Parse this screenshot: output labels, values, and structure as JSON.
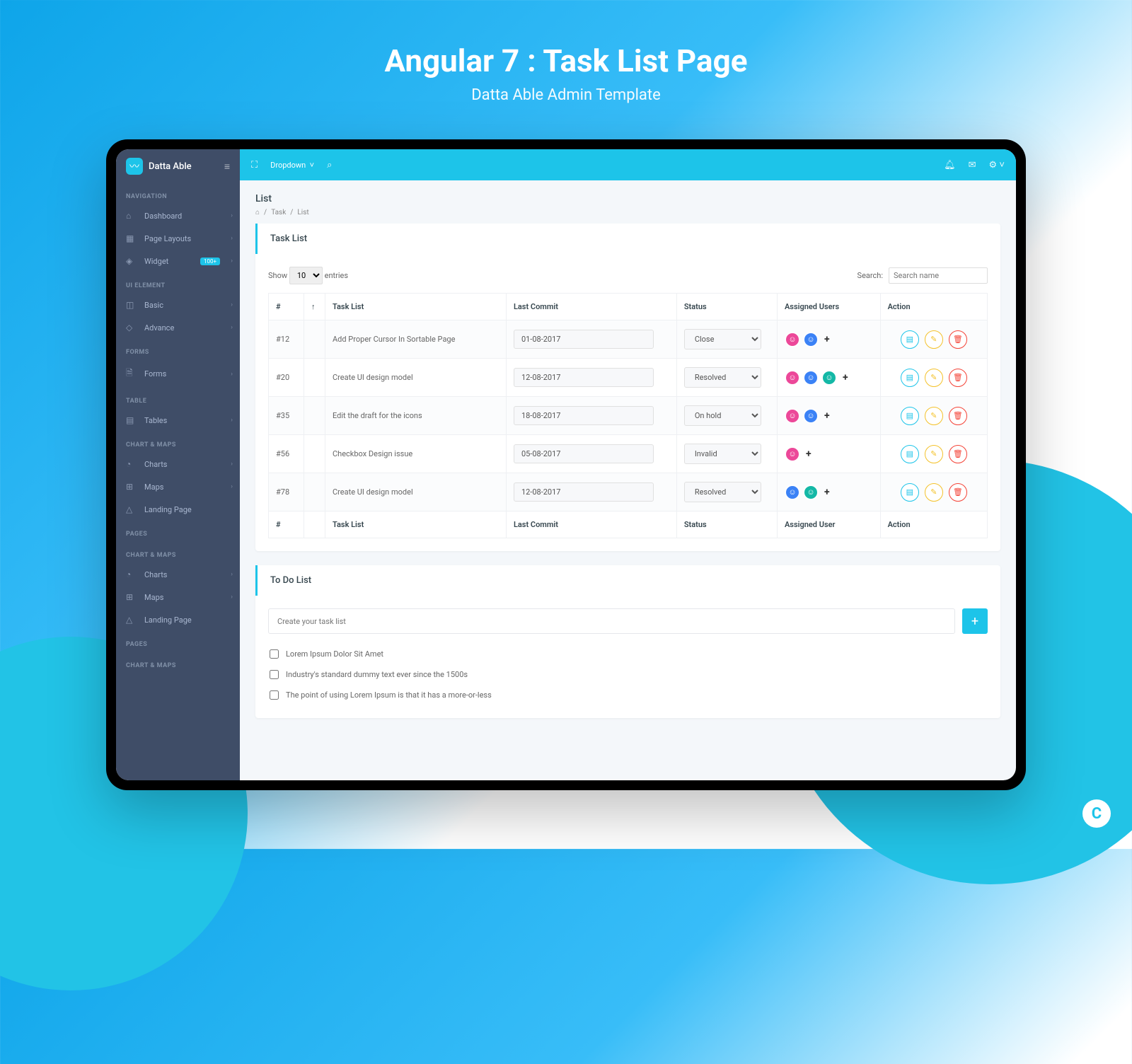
{
  "hero": {
    "title": "Angular 7 : Task List Page",
    "subtitle": "Datta Able Admin Template"
  },
  "app_name": "Datta Able",
  "topbar": {
    "dropdown": "Dropdown"
  },
  "sidebar": {
    "sections": [
      {
        "heading": "NAVIGATION",
        "items": [
          {
            "icon": "⌂",
            "label": "Dashboard",
            "chev": true
          },
          {
            "icon": "▦",
            "label": "Page Layouts",
            "chev": true
          },
          {
            "icon": "◈",
            "label": "Widget",
            "badge": "100+",
            "chev": true
          }
        ]
      },
      {
        "heading": "UI ELEMENT",
        "items": [
          {
            "icon": "◫",
            "label": "Basic",
            "chev": true
          },
          {
            "icon": "◇",
            "label": "Advance",
            "chev": true
          }
        ]
      },
      {
        "heading": "FORMS",
        "items": [
          {
            "icon": "🗎",
            "label": "Forms",
            "chev": true
          }
        ]
      },
      {
        "heading": "TABLE",
        "items": [
          {
            "icon": "▤",
            "label": "Tables",
            "chev": true
          }
        ]
      },
      {
        "heading": "CHART & MAPS",
        "items": [
          {
            "icon": "◔",
            "label": "Charts",
            "chev": true
          },
          {
            "icon": "⊞",
            "label": "Maps",
            "chev": true
          },
          {
            "icon": "△",
            "label": "Landing Page",
            "chev": false
          }
        ]
      },
      {
        "heading": "PAGES",
        "items": []
      },
      {
        "heading": "CHART & MAPS",
        "items": [
          {
            "icon": "◔",
            "label": "Charts",
            "chev": true
          },
          {
            "icon": "⊞",
            "label": "Maps",
            "chev": true
          },
          {
            "icon": "△",
            "label": "Landing Page",
            "chev": false
          }
        ]
      },
      {
        "heading": "PAGES",
        "items": []
      },
      {
        "heading": "CHART & MAPS",
        "items": []
      }
    ]
  },
  "page": {
    "title": "List",
    "breadcrumb": [
      "⌂",
      "Task",
      "List"
    ]
  },
  "task_card": {
    "title": "Task List",
    "show_label": "Show",
    "entries_label": "entries",
    "entries_value": "10",
    "search_label": "Search:",
    "search_placeholder": "Search name",
    "columns": [
      "#",
      "↑",
      "Task List",
      "Last Commit",
      "Status",
      "Assigned Users",
      "Action"
    ],
    "footer": [
      "#",
      "",
      "Task List",
      "Last Commit",
      "Status",
      "Assigned User",
      "Action"
    ],
    "rows": [
      {
        "id": "#12",
        "task": "Add Proper Cursor In Sortable Page",
        "date": "01-08-2017",
        "status": "Close",
        "avatars": [
          "pink",
          "blue"
        ]
      },
      {
        "id": "#20",
        "task": "Create UI design model",
        "date": "12-08-2017",
        "status": "Resolved",
        "avatars": [
          "pink",
          "blue",
          "teal"
        ]
      },
      {
        "id": "#35",
        "task": "Edit the draft for the icons",
        "date": "18-08-2017",
        "status": "On hold",
        "avatars": [
          "pink",
          "blue"
        ]
      },
      {
        "id": "#56",
        "task": "Checkbox Design issue",
        "date": "05-08-2017",
        "status": "Invalid",
        "avatars": [
          "pink"
        ]
      },
      {
        "id": "#78",
        "task": "Create UI design model",
        "date": "12-08-2017",
        "status": "Resolved",
        "avatars": [
          "blue",
          "teal"
        ]
      }
    ]
  },
  "todo_card": {
    "title": "To Do List",
    "placeholder": "Create your task list",
    "items": [
      "Lorem Ipsum Dolor Sit Amet",
      "Industry's standard dummy text ever since the 1500s",
      "The point of using Lorem Ipsum is that it has a more-or-less"
    ]
  }
}
